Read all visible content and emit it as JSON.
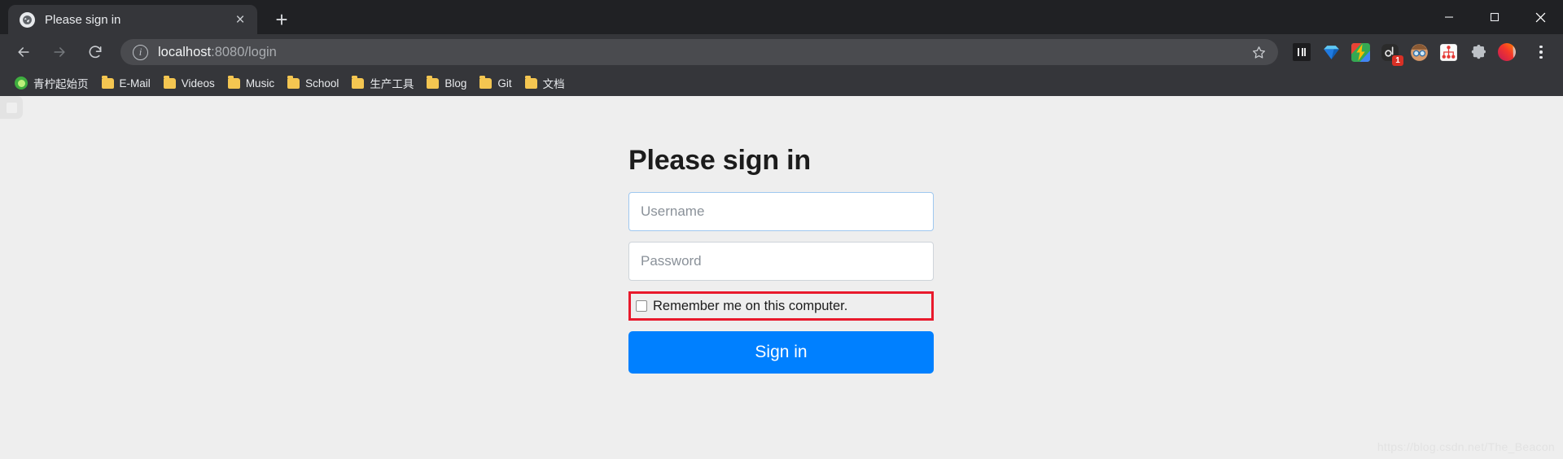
{
  "window": {
    "minimize_label": "Minimize",
    "maximize_label": "Restore",
    "close_label": "Close"
  },
  "tabstrip": {
    "tabs": [
      {
        "title": "Please sign in",
        "favicon": "globe-icon",
        "close_label": "×"
      }
    ],
    "new_tab_label": "+"
  },
  "toolbar": {
    "back_label": "←",
    "forward_label": "→",
    "reload_label": "⟳",
    "site_info_label": "i",
    "url_host": "localhost",
    "url_path": ":8080/login",
    "bookmark_star": "star-icon",
    "extensions": [
      {
        "name": "li-extension-icon",
        "label": "LI"
      },
      {
        "name": "diamond-extension-icon",
        "label": ""
      },
      {
        "name": "colorful-z-extension-icon",
        "label": ""
      },
      {
        "name": "notification-extension-icon",
        "label": "",
        "badge": "1"
      },
      {
        "name": "goggles-face-extension-icon",
        "label": ""
      },
      {
        "name": "mindmap-extension-icon",
        "label": ""
      },
      {
        "name": "puzzle-extensions-icon",
        "label": ""
      },
      {
        "name": "profile-avatar-icon",
        "label": ""
      }
    ],
    "menu_label": "Customize and control"
  },
  "bookmarks": [
    {
      "label": "青柠起始页",
      "icon": "lime-icon"
    },
    {
      "label": "E-Mail",
      "icon": "folder-icon"
    },
    {
      "label": "Videos",
      "icon": "folder-icon"
    },
    {
      "label": "Music",
      "icon": "folder-icon"
    },
    {
      "label": "School",
      "icon": "folder-icon"
    },
    {
      "label": "生产工具",
      "icon": "folder-icon"
    },
    {
      "label": "Blog",
      "icon": "folder-icon"
    },
    {
      "label": "Git",
      "icon": "folder-icon"
    },
    {
      "label": "文档",
      "icon": "folder-icon"
    }
  ],
  "page": {
    "heading": "Please sign in",
    "username": {
      "value": "",
      "placeholder": "Username"
    },
    "password": {
      "value": "",
      "placeholder": "Password"
    },
    "remember": {
      "label": "Remember me on this computer.",
      "checked": false
    },
    "submit_label": "Sign in",
    "watermark": "https://blog.csdn.net/The_Beacon",
    "side_widget_label": "panel-toggle"
  },
  "colors": {
    "chrome_dark": "#202124",
    "chrome_toolbar": "#35363a",
    "page_bg": "#eeeeee",
    "accent_blue": "#0080ff",
    "annotation_red": "#e8192c",
    "focus_border": "#9fc8ef"
  }
}
